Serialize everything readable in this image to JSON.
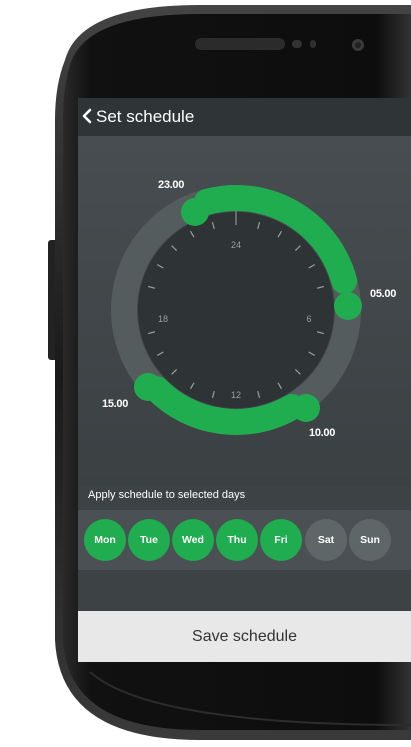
{
  "header": {
    "back_icon": "chevron-left-icon",
    "title": "Set schedule"
  },
  "dial": {
    "hour_labels": [
      "24",
      "6",
      "12",
      "18"
    ],
    "handle_labels": [
      "23.00",
      "05.00",
      "10.00",
      "15.00"
    ],
    "schedule_ranges": [
      {
        "start": "23.00",
        "end": "05.00"
      },
      {
        "start": "10.00",
        "end": "15.00"
      }
    ],
    "accent_color": "#1fad4f"
  },
  "days": {
    "caption": "Apply schedule to selected days",
    "items": [
      {
        "label": "Mon",
        "selected": true
      },
      {
        "label": "Tue",
        "selected": true
      },
      {
        "label": "Wed",
        "selected": true
      },
      {
        "label": "Thu",
        "selected": true
      },
      {
        "label": "Fri",
        "selected": true
      },
      {
        "label": "Sat",
        "selected": false
      },
      {
        "label": "Sun",
        "selected": false
      }
    ]
  },
  "footer": {
    "save_label": "Save schedule"
  }
}
